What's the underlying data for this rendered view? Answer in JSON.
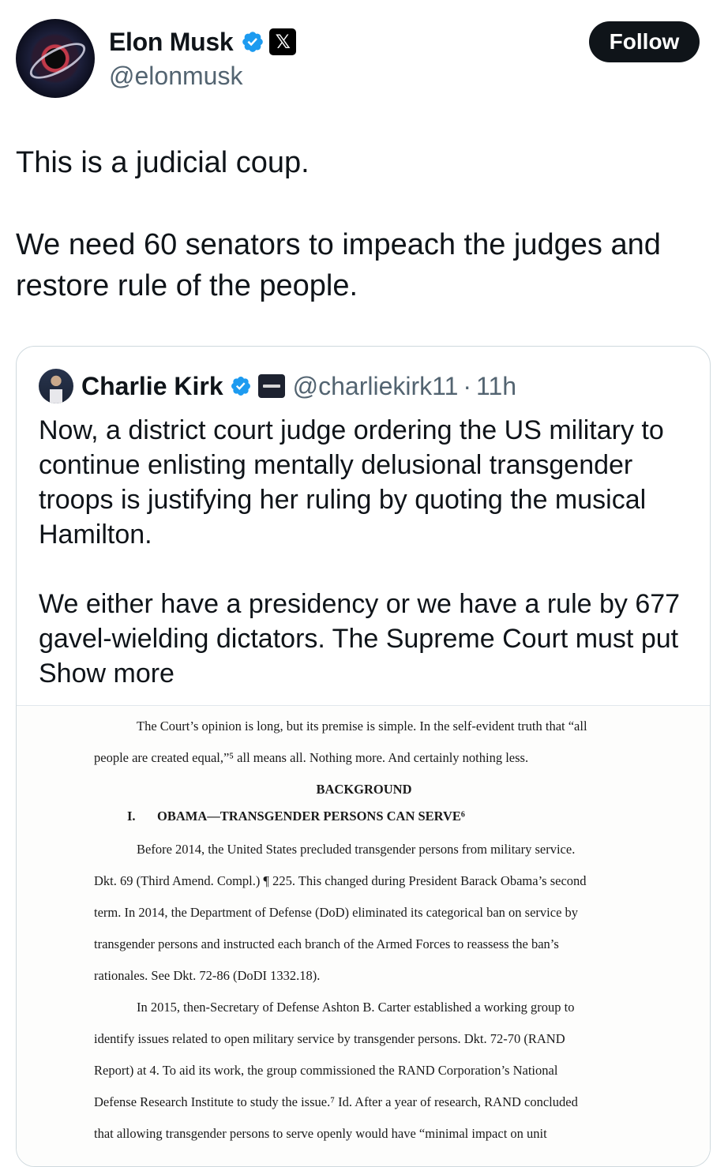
{
  "author": {
    "display_name": "Elon Musk",
    "handle": "@elonmusk",
    "verified_icon": "verified-badge-icon",
    "affiliation_icon": "x-logo-icon",
    "affiliation_glyph": "𝕏"
  },
  "follow_label": "Follow",
  "tweet": {
    "paragraphs": [
      "This is a judicial coup.",
      "We need 60 senators to impeach the judges and restore rule of the people."
    ]
  },
  "quote": {
    "display_name": "Charlie Kirk",
    "handle": "@charliekirk11",
    "separator": "·",
    "time": "11h",
    "paragraph1": "Now, a district court judge ordering the US military to continue enlisting mentally delusional transgender troops is justifying her ruling by quoting the musical Hamilton.",
    "paragraph2_text": "We either have a presidency or we have a rule by 677 gavel-wielding dictators. The Supreme Court must put",
    "show_more": "Show more"
  },
  "document": {
    "lines": [
      "The Court’s opinion is long, but its premise is simple.  In the self-evident truth that “all",
      "people are created equal,”⁵ all means all.  Nothing more.  And certainly nothing less.",
      "Before 2014, the United States precluded transgender persons from military service.",
      "Dkt. 69 (Third Amend. Compl.) ¶ 225.  This changed during President Barack Obama’s second",
      "term.  In 2014, the Department of Defense (DoD) eliminated its categorical ban on service by",
      "transgender persons and instructed each branch of the Armed Forces to reassess the ban’s",
      "rationales.  See Dkt. 72-86 (DoDI 1332.18).",
      "In 2015, then-Secretary of Defense Ashton B. Carter established a working group to",
      "identify issues related to open military service by transgender persons.  Dkt. 72-70 (RAND",
      "Report) at 4.  To aid its work, the group commissioned the RAND Corporation’s National",
      "Defense Research Institute to study the issue.⁷  Id.  After a year of research, RAND concluded",
      "that allowing transgender persons to serve openly would have “minimal impact on unit"
    ],
    "heading": "BACKGROUND",
    "section_number": "I.",
    "section_title": "OBAMA—TRANSGENDER PERSONS CAN SERVE⁶"
  }
}
